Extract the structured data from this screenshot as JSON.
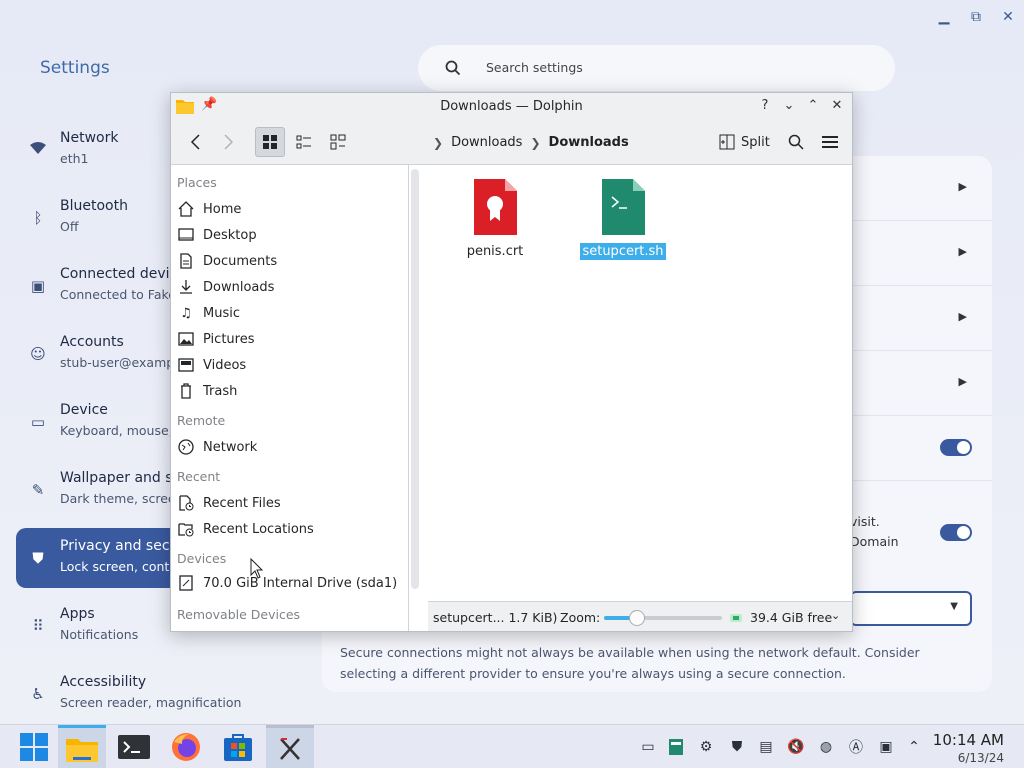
{
  "settings": {
    "title": "Settings",
    "search_placeholder": "Search settings",
    "nav": [
      {
        "title": "Network",
        "sub": "eth1",
        "icon": "wifi-icon"
      },
      {
        "title": "Bluetooth",
        "sub": "Off",
        "icon": "bluetooth-icon"
      },
      {
        "title": "Connected devices",
        "sub": "Connected to Fake",
        "icon": "devices-icon"
      },
      {
        "title": "Accounts",
        "sub": "stub-user@example",
        "icon": "account-icon"
      },
      {
        "title": "Device",
        "sub": "Keyboard, mouse,",
        "icon": "laptop-icon"
      },
      {
        "title": "Wallpaper and style",
        "sub": "Dark theme, screen",
        "icon": "paint-icon"
      },
      {
        "title": "Privacy and security",
        "sub": "Lock screen, control",
        "icon": "shield-icon"
      },
      {
        "title": "Apps",
        "sub": "Notifications",
        "icon": "apps-grid-icon"
      },
      {
        "title": "Accessibility",
        "sub": "Screen reader, magnification",
        "icon": "accessibility-icon"
      }
    ],
    "dns_fragment_1": "visit.",
    "dns_fragment_2": "Domain",
    "secure_note": "Secure connections might not always be available when using the network default. Consider selecting a different provider to ensure you're always using a secure connection."
  },
  "dolphin": {
    "title": "Downloads — Dolphin",
    "breadcrumb": [
      "Downloads",
      "Downloads"
    ],
    "split_label": "Split",
    "places_sections": {
      "places": "Places",
      "remote": "Remote",
      "recent": "Recent",
      "devices": "Devices",
      "removable": "Removable Devices"
    },
    "places": [
      "Home",
      "Desktop",
      "Documents",
      "Downloads",
      "Music",
      "Pictures",
      "Videos",
      "Trash"
    ],
    "remote": [
      "Network"
    ],
    "recent": [
      "Recent Files",
      "Recent Locations"
    ],
    "devices": [
      "70.0 GiB Internal Drive (sda1)"
    ],
    "drive_usage_fraction": 0.42,
    "files": [
      {
        "name": "penis.crt",
        "type": "certificate",
        "color": "#da1f26"
      },
      {
        "name": "setupcert.sh",
        "type": "shell-script",
        "color": "#1f8a6e",
        "selected": true
      }
    ],
    "status_text": "setupcert... 1.7 KiB)",
    "zoom_label": "Zoom:",
    "zoom_fraction": 0.28,
    "free_space": "39.4 GiB free"
  },
  "taskbar": {
    "time": "10:14 AM",
    "date": "6/13/24"
  },
  "colors": {
    "accent": "#3a5aa0",
    "selection": "#3daee9"
  }
}
